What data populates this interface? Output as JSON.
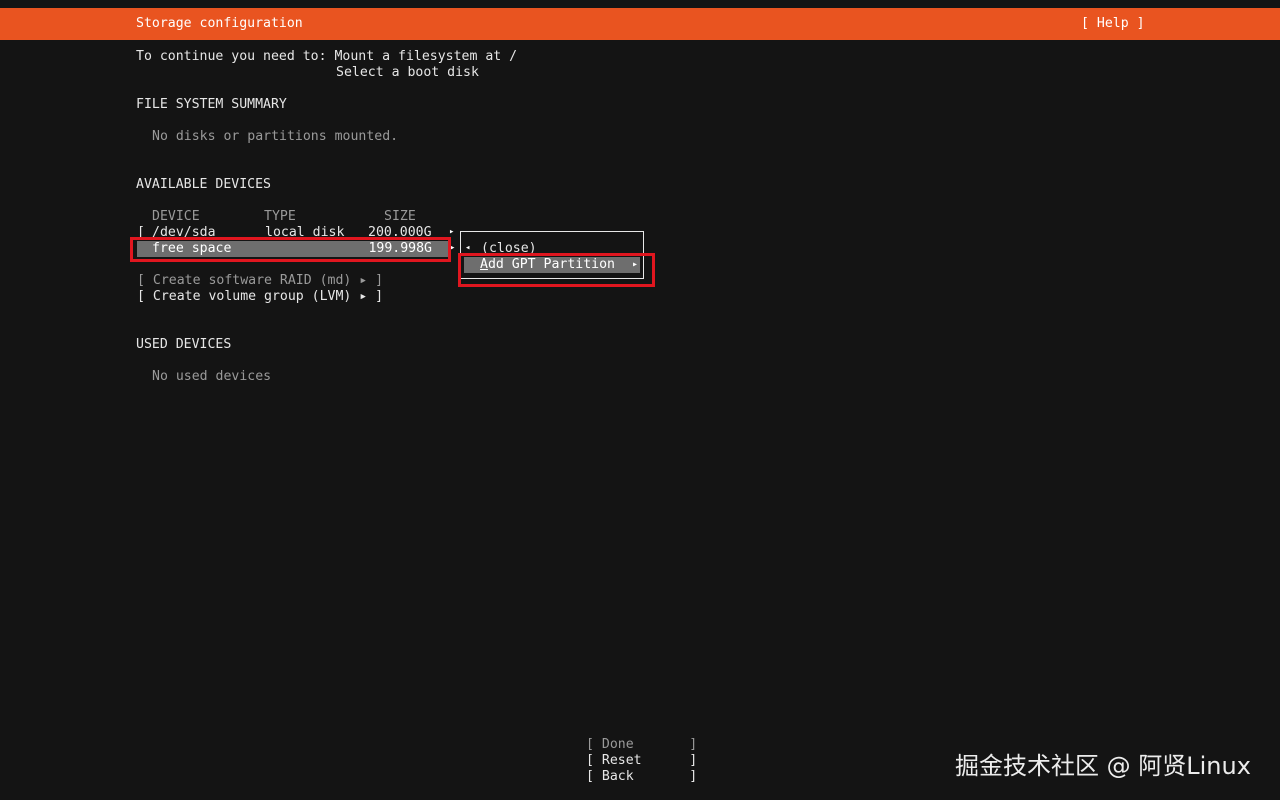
{
  "header": {
    "title": "Storage configuration",
    "help": "[ Help ]"
  },
  "intro": {
    "line1": "To continue you need to: Mount a filesystem at /",
    "line2": "Select a boot disk"
  },
  "fs_summary": {
    "heading": "FILE SYSTEM SUMMARY",
    "empty": "No disks or partitions mounted."
  },
  "available": {
    "heading": "AVAILABLE DEVICES",
    "columns": [
      "DEVICE",
      "TYPE",
      "SIZE"
    ],
    "disk_row": {
      "bracket": "[",
      "device": "/dev/sda",
      "type": "local disk",
      "size": "200.000G",
      "arrow": "▸"
    },
    "free_row": {
      "device": "free space",
      "size": "199.998G",
      "arrow": "▸"
    },
    "create_raid": "[ Create software RAID (md) ▸ ]",
    "create_lvm": "[ Create volume group (LVM) ▸ ]"
  },
  "popup": {
    "close_arrow": "◂",
    "close": "(close)",
    "add_gpt_first": "A",
    "add_gpt_rest": "dd GPT Partition",
    "add_gpt_arrow": "▸"
  },
  "used": {
    "heading": "USED DEVICES",
    "empty": "No used devices"
  },
  "footer": {
    "done": "[ Done       ]",
    "reset": "[ Reset      ]",
    "back": "[ Back       ]"
  },
  "watermark": "掘金技术社区 @ 阿贤Linux",
  "colors": {
    "accent": "#e95420",
    "highlight_box": "#e0161f",
    "selection": "#6e6e6e",
    "background": "#141414"
  }
}
